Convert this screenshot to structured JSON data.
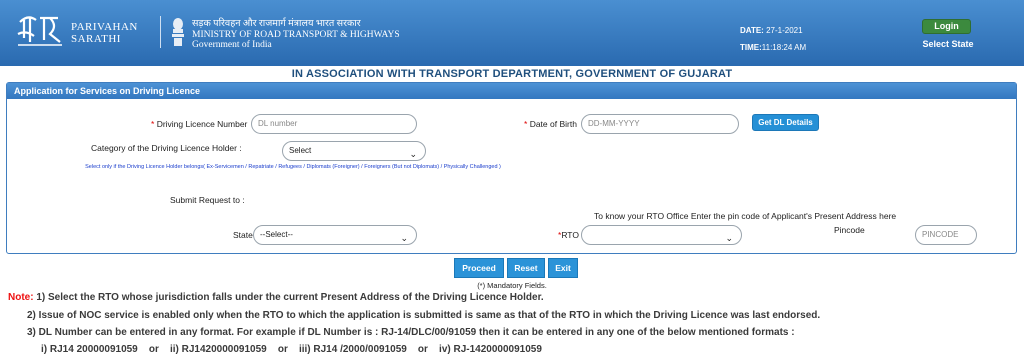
{
  "header": {
    "brand_line1": "PARIVAHAN",
    "brand_line2": "SARATHI",
    "ministry_hindi": "सड़क परिवहन और राजमार्ग मंत्रालय भारत सरकार",
    "ministry_line1": "MINISTRY OF ROAD TRANSPORT & HIGHWAYS",
    "ministry_line2": "Government of India",
    "date_label": "DATE:",
    "date_value": "27-1-2021",
    "time_label": "TIME:",
    "time_value": "11:18:24 AM",
    "login_label": "Login",
    "select_state_label": "Select State"
  },
  "association": "IN ASSOCIATION WITH TRANSPORT DEPARTMENT, GOVERNMENT OF GUJARAT",
  "panel": {
    "title": "Application for Services on Driving Licence",
    "dl_number_label": "Driving Licence Number",
    "dl_number_placeholder": "DL number",
    "dob_label": "Date of Birth",
    "dob_placeholder": "DD-MM-YYYY",
    "get_dl_details_label": "Get DL Details",
    "category_label": "Category of the Driving Licence Holder :",
    "category_selected": "Select",
    "category_note": "Select only if the Driving Licence Holder belongs( Ex-Servicemen / Repatriate / Refugees / Diplomats (Foreigner) / Foreigners (But not Diplomats) / Physically Challenged )",
    "submit_request_label": "Submit Request to :",
    "pin_hint": "To know your RTO Office Enter the pin code of Applicant's Present Address here",
    "state_label": "State",
    "state_selected": "--Select--",
    "rto_label": "RTO",
    "rto_selected": "",
    "pincode_label": "Pincode",
    "pincode_placeholder": "PINCODE",
    "required_marker": "*"
  },
  "actions": {
    "proceed": "Proceed",
    "reset": "Reset",
    "exit": "Exit"
  },
  "mandatory_text": "(*) Mandatory Fields.",
  "notes": {
    "label": "Note:",
    "line1": "1) Select the RTO whose jurisdiction falls under the current Present Address of the Driving Licence Holder.",
    "line2": "2) Issue of NOC service is enabled only when the RTO to which the application is submitted is same as that of the RTO in which the Driving Licence was last endorsed.",
    "line3": "3) DL Number can be entered in any format. For example if DL Number is : RJ-14/DLC/00/91059 then it can be entered in any one of the below mentioned formats :",
    "line4": "i) RJ14 20000091059    or    ii) RJ1420000091059    or    iii) RJ14 /2000/0091059    or    iv) RJ-1420000091059"
  },
  "colors": {
    "header_blue": "#2a6ab0",
    "button_blue": "#2b93d8",
    "login_green": "#3c8a3e",
    "note_red": "#e11"
  }
}
